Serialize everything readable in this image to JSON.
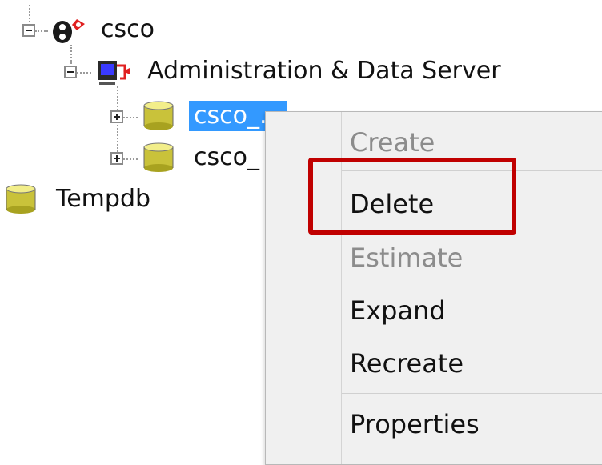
{
  "tree": {
    "root_label": "csco",
    "admin_server_label": "Administration & Data Server",
    "db1_label": "csco_...",
    "db2_label": "csco_",
    "tempdb_label": "Tempdb"
  },
  "context_menu": {
    "items": [
      {
        "label": "Create",
        "enabled": false
      },
      {
        "label": "Delete",
        "enabled": true,
        "highlighted": true
      },
      {
        "label": "Estimate",
        "enabled": false
      },
      {
        "label": "Expand",
        "enabled": true
      },
      {
        "label": "Recreate",
        "enabled": true
      },
      {
        "label": "Properties",
        "enabled": true
      }
    ]
  },
  "colors": {
    "selection": "#3399ff",
    "highlight_box": "#c00000",
    "menu_background": "#f0f0f0",
    "disabled_text": "#8c8c8c"
  },
  "icons": {
    "root": "server-group-icon",
    "admin_server": "admin-server-icon",
    "database": "database-icon"
  }
}
